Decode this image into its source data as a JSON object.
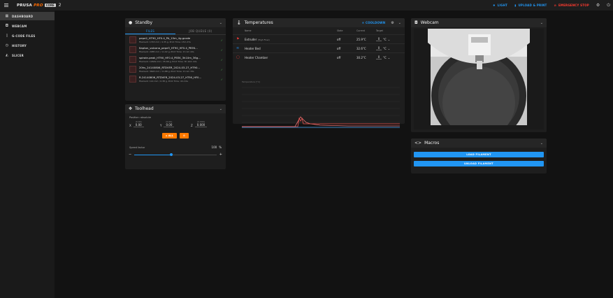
{
  "app": {
    "logo_main": "PRUSA",
    "logo_pro": "PRO",
    "logo_badge": "CORE",
    "instance_number": "2"
  },
  "topbar": {
    "light_label": "LIGHT",
    "upload_label": "UPLOAD & PRINT",
    "estop_label": "EMERGENCY STOP"
  },
  "sidebar": {
    "items": [
      {
        "label": "DASHBOARD",
        "icon": "dashboard-icon"
      },
      {
        "label": "WEBCAM",
        "icon": "webcam-icon"
      },
      {
        "label": "G-CODE FILES",
        "icon": "file-icon"
      },
      {
        "label": "HISTORY",
        "icon": "history-icon"
      },
      {
        "label": "SLICER",
        "icon": "slicer-icon"
      }
    ]
  },
  "standby": {
    "title": "Standby",
    "tab_files": "FILES",
    "tab_queue": "JOB QUEUE (0)",
    "files": [
      {
        "name": "pepe2_HT90_HF0.4_PA_15m_4g.gcode",
        "info": "Filament: 1743 mm / 4.35 g, Print Time: 15m 27s"
      },
      {
        "name": "Kapton_volcano_pepe3_HT90_HF0.4_PEEK...",
        "info": "Filament: 2085 mm / 11.02 g, Print Time: 1h 1m 22s"
      },
      {
        "name": "spirale-peak_HT90_HF0.4_PEEK_3h10m_36g...",
        "info": "Filament: 12649 mm / 35.66 g, Print Time: 3h 10m 22s"
      },
      {
        "name": "20hs_24140806_RTDVER_2024-03-27_HT90...",
        "info": "Filament: 3693 mm / 11.88 g, Print Time: 1h 1m 33s"
      },
      {
        "name": "R-24140806_RTDVER_2024-03-27_HT90_HF0...",
        "info": "Filament: 114 mm / 0.38 g, Print Time: 4m 41s"
      }
    ]
  },
  "toolhead": {
    "title": "Toolhead",
    "position_label": "Position: absolute",
    "axes": [
      {
        "label": "X",
        "sub": "(0.00)",
        "value": "0.00"
      },
      {
        "label": "Y",
        "sub": "(0.00)",
        "value": "0.00"
      },
      {
        "label": "Z",
        "sub": "(0.000)",
        "value": "0.000"
      }
    ],
    "home_all_label": "ALL",
    "speed_label": "Speed factor",
    "speed_value": "100",
    "speed_unit": "%",
    "speed_fraction": 0.45
  },
  "temperatures": {
    "title": "Temperatures",
    "cooldown_label": "COOLDOWN",
    "headers": {
      "name": "Name",
      "state": "State",
      "current": "Current",
      "target": "Target"
    },
    "rows": [
      {
        "name": "Extruder",
        "sub": "(High Flow)",
        "state": "off",
        "current": "25.9°C",
        "target": "0",
        "unit": "°C",
        "color": "#e53935"
      },
      {
        "name": "Heater Bed",
        "sub": "",
        "state": "off",
        "current": "32.6°C",
        "target": "0",
        "unit": "°C",
        "color": "#1e88e5"
      },
      {
        "name": "Heater Chamber",
        "sub": "",
        "state": "off",
        "current": "30.2°C",
        "target": "0",
        "unit": "°C",
        "color": "#e53935"
      }
    ],
    "chart_legend": "Temperature [°C]"
  },
  "webcam": {
    "title": "Webcam"
  },
  "macros": {
    "title": "Macros",
    "buttons": [
      "LOAD FILAMENT",
      "UNLOAD FILAMENT"
    ]
  }
}
